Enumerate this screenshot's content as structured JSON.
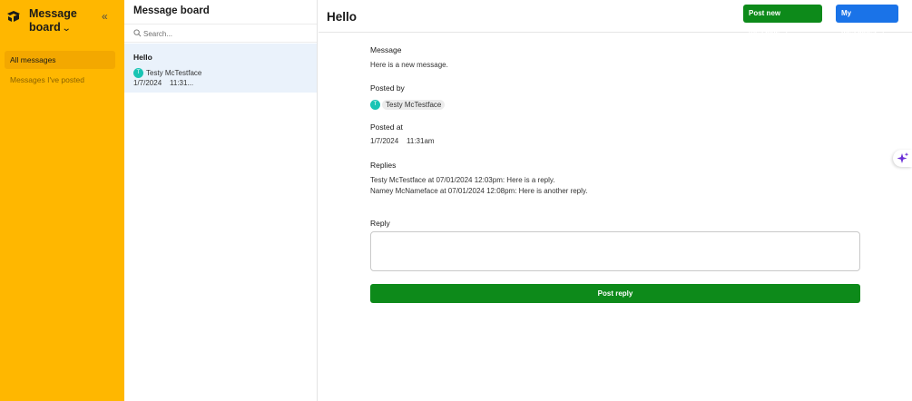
{
  "sidebar": {
    "app_title": "Message board",
    "collapse_icon": "double-chevron-left-icon",
    "logo_icon": "app-logo-icon",
    "items": [
      {
        "label": "All messages",
        "active": true
      },
      {
        "label": "Messages I've posted",
        "active": false
      }
    ],
    "colors": {
      "background": "#ffb700",
      "active": "#f3a800"
    }
  },
  "list": {
    "title": "Message board",
    "search": {
      "placeholder": "Search...",
      "value": ""
    },
    "items": [
      {
        "title": "Hello",
        "author": "Testy McTestface",
        "author_initial": "T",
        "date": "1/7/2024",
        "time": "11:31..."
      }
    ]
  },
  "main": {
    "title": "Hello",
    "buttons": {
      "post_new": "Post new message",
      "my_messages": "My messages"
    },
    "message": {
      "label": "Message",
      "value": "Here is a new message."
    },
    "posted_by": {
      "label": "Posted by",
      "author": "Testy McTestface",
      "author_initial": "T"
    },
    "posted_at": {
      "label": "Posted at",
      "date": "1/7/2024",
      "time": "11:31am"
    },
    "replies": {
      "label": "Replies",
      "items": [
        "Testy McTestface at 07/01/2024 12:03pm: Here is a reply.",
        "Namey McNameface at 07/01/2024 12:08pm: Here is another reply."
      ]
    },
    "reply": {
      "label": "Reply",
      "value": "",
      "button": "Post reply"
    },
    "colors": {
      "green": "#0d8a1a",
      "blue": "#1a73e8",
      "avatar": "#19c4b4"
    }
  },
  "assistant_icon": "sparkle-icon"
}
